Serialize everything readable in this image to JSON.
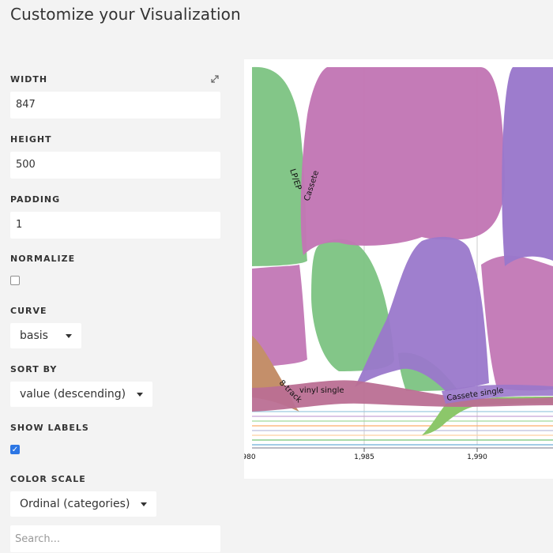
{
  "page": {
    "title": "Customize your Visualization"
  },
  "controls": {
    "width": {
      "label": "WIDTH",
      "value": "847"
    },
    "height": {
      "label": "HEIGHT",
      "value": "500"
    },
    "padding": {
      "label": "PADDING",
      "value": "1"
    },
    "normalize": {
      "label": "NORMALIZE",
      "checked": false
    },
    "curve": {
      "label": "CURVE",
      "value": "basis"
    },
    "sort_by": {
      "label": "SORT BY",
      "value": "value (descending)"
    },
    "show_labels": {
      "label": "SHOW LABELS",
      "checked": true
    },
    "color_scale": {
      "label": "COLOR SCALE",
      "value": "Ordinal (categories)"
    },
    "search": {
      "placeholder": "Search..."
    }
  },
  "colors": {
    "background": "#f3f3f3",
    "green": "#7cc382",
    "magenta": "#c277b5",
    "purple": "#9a78cb",
    "brown": "#c48f6a",
    "rose": "#bb6f93",
    "checkbox": "#2c76e4"
  },
  "chart_data": {
    "type": "area",
    "x_ticks": [
      "980",
      "1,985",
      "1,990"
    ],
    "labels": [
      "LP/EP",
      "Cassete",
      "8-track",
      "vinyl single",
      "Cassete single"
    ]
  }
}
